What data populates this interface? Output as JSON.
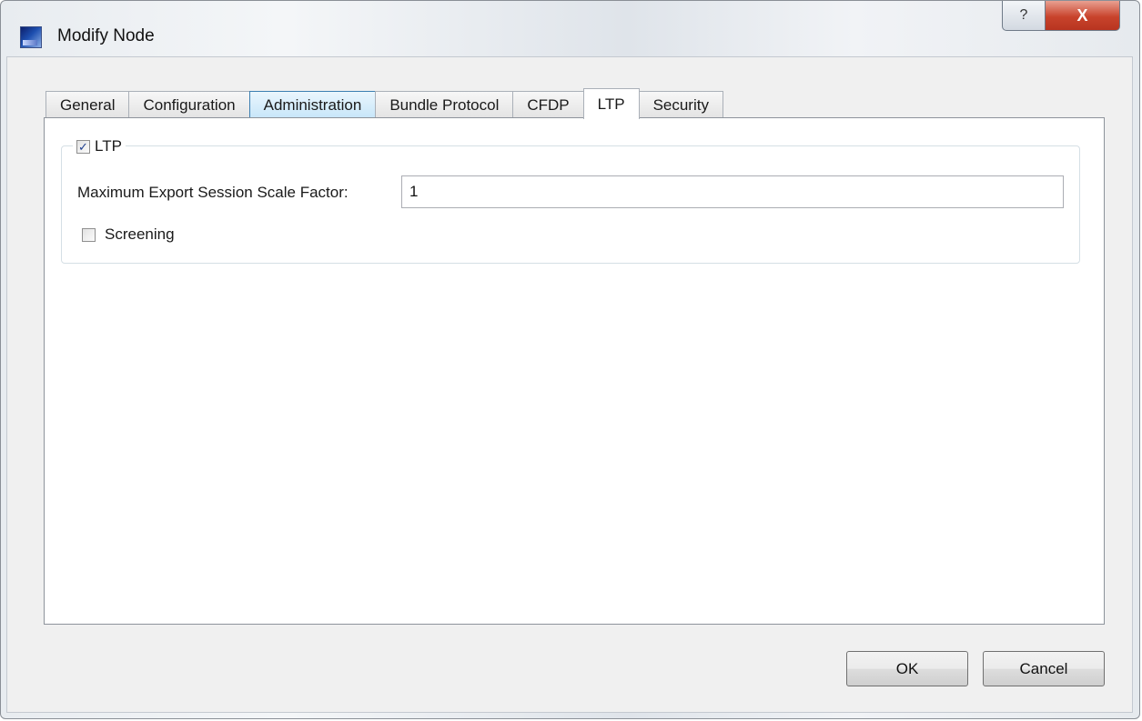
{
  "window": {
    "title": "Modify Node",
    "help_glyph": "?",
    "close_glyph": "X"
  },
  "tabs": [
    {
      "label": "General",
      "state": "normal"
    },
    {
      "label": "Configuration",
      "state": "normal"
    },
    {
      "label": "Administration",
      "state": "hover"
    },
    {
      "label": "Bundle Protocol",
      "state": "normal"
    },
    {
      "label": "CFDP",
      "state": "normal"
    },
    {
      "label": "LTP",
      "state": "active"
    },
    {
      "label": "Security",
      "state": "normal"
    }
  ],
  "ltp_group": {
    "checkbox_label": "LTP",
    "checked": true,
    "check_glyph": "✓",
    "scale_factor_label": "Maximum Export Session Scale Factor:",
    "scale_factor_value": "1",
    "screening_label": "Screening",
    "screening_checked": false
  },
  "buttons": {
    "ok": "OK",
    "cancel": "Cancel"
  }
}
